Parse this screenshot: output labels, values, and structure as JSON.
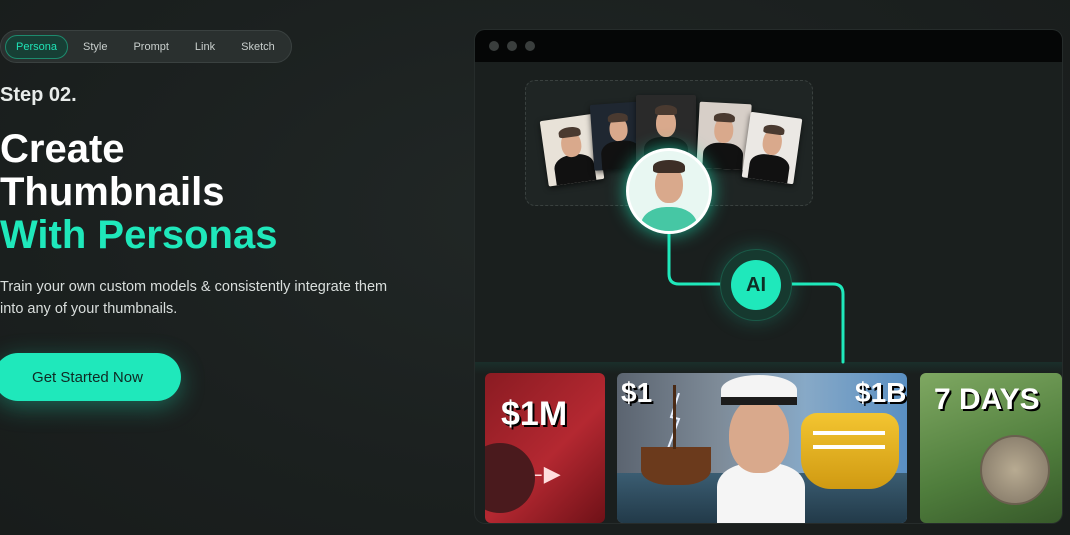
{
  "tabs": [
    {
      "label": "Persona",
      "active": true
    },
    {
      "label": "Style",
      "active": false
    },
    {
      "label": "Prompt",
      "active": false
    },
    {
      "label": "Link",
      "active": false
    },
    {
      "label": "Sketch",
      "active": false
    }
  ],
  "hero": {
    "step": "Step 02.",
    "title_line1": "Create",
    "title_line2": "Thumbnails",
    "title_accent": "With Personas",
    "description": "Train your own custom models & consistently integrate them into any of your thumbnails.",
    "cta_label": "Get Started Now"
  },
  "panel": {
    "ai_label": "AI",
    "thumbnails": [
      {
        "label": "$1M"
      },
      {
        "label_left": "$1",
        "label_right": "$1B"
      },
      {
        "label": "7 DAYS"
      }
    ]
  },
  "colors": {
    "accent": "#1fe8bb",
    "background": "#1b201f"
  }
}
